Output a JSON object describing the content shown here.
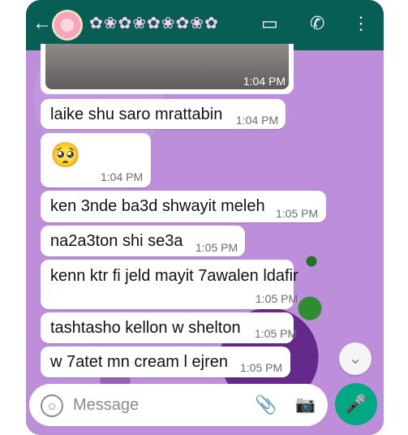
{
  "header": {
    "back_icon": "arrow-left",
    "title_decoration": "✿❀✿❀✿❀✿❀✿",
    "video_icon": "video-icon",
    "call_icon": "phone-icon",
    "menu_icon": "more-vertical-icon"
  },
  "messages": [
    {
      "text": "",
      "time": "1:04 PM"
    },
    {
      "text": "laike shu saro mrattabin",
      "time": "1:04 PM"
    },
    {
      "text": "🥺",
      "time": "1:04 PM"
    },
    {
      "text": "ken 3nde ba3d shwayit meleh",
      "time": "1:05 PM"
    },
    {
      "text": "na2a3ton shi se3a",
      "time": "1:05 PM"
    },
    {
      "text": "kenn ktr fi jeld mayit 7awalen ldafir",
      "time": "1:05 PM"
    },
    {
      "text": "tashtasho kellon w shelton",
      "time": "1:05 PM"
    },
    {
      "text": "w 7atet mn cream l ejren",
      "time": "1:05 PM"
    }
  ],
  "composer": {
    "placeholder": "Message",
    "emoji_icon": "emoji-icon",
    "attach_icon": "paperclip-icon",
    "camera_icon": "camera-icon",
    "mic_icon": "mic-icon",
    "scroll_down_icon": "chevron-double-down-icon"
  },
  "colors": {
    "header": "#075e54",
    "bubble": "#ffffff",
    "wallpaper": "#bd8ed9",
    "accent": "#00a884"
  }
}
